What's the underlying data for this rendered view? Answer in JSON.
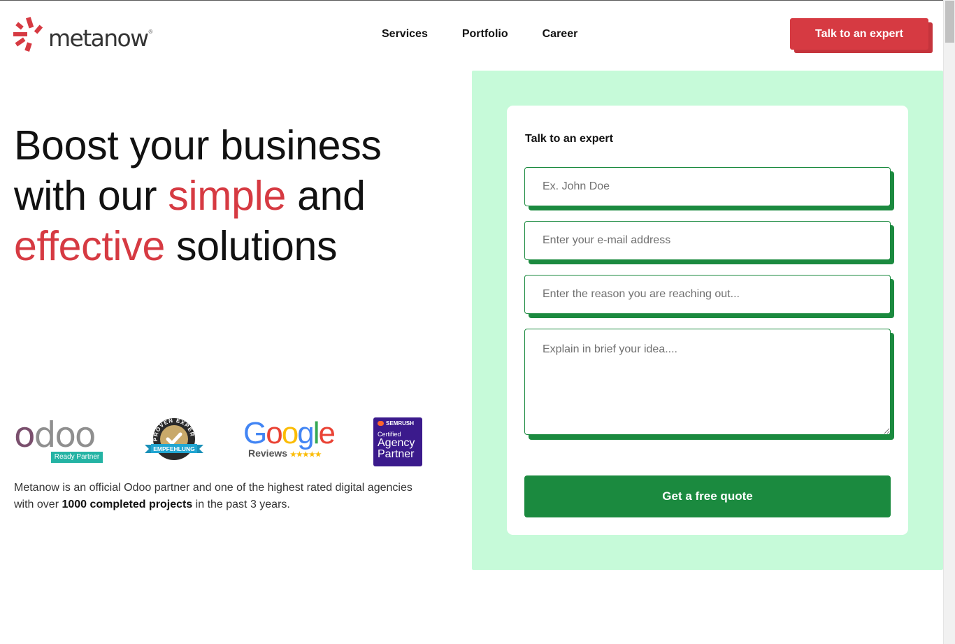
{
  "header": {
    "logo_text": "metanow",
    "logo_reg": "®",
    "logo_icon": "burst-logo-icon",
    "nav": [
      "Services",
      "Portfolio",
      "Career"
    ],
    "cta_label": "Talk to an expert"
  },
  "hero": {
    "line1": "Boost your business",
    "line2_a": "with our ",
    "line2_b": "simple",
    "line2_c": " and",
    "line3_a": "effective",
    "line3_b": " solutions",
    "accent_color": "#d63a42"
  },
  "badges": {
    "odoo_word_first": "o",
    "odoo_word_rest": "doo",
    "odoo_tag": "Ready Partner",
    "proven_top": "PROVEN EXPERT",
    "proven_ribbon": "EMPFEHLUNG",
    "google_reviews": "Reviews",
    "google_stars": "★★★★★",
    "semrush_brand": "SEMRUSH",
    "semrush_cert": "Certified",
    "semrush_line1": "Agency",
    "semrush_line2": "Partner"
  },
  "description": {
    "part1": "Metanow is an official Odoo partner and one of the highest rated digital agencies with over ",
    "bold": "1000 completed projects",
    "part2": " in the past 3 years."
  },
  "form": {
    "title": "Talk to an expert",
    "name_placeholder": "Ex. John Doe",
    "email_placeholder": "Enter your e-mail address",
    "reason_placeholder": "Enter the reason you are reaching out...",
    "idea_placeholder": "Explain in brief your idea....",
    "submit_label": "Get a free quote",
    "panel_color": "#c6fad9",
    "field_accent": "#1b8a3f"
  }
}
